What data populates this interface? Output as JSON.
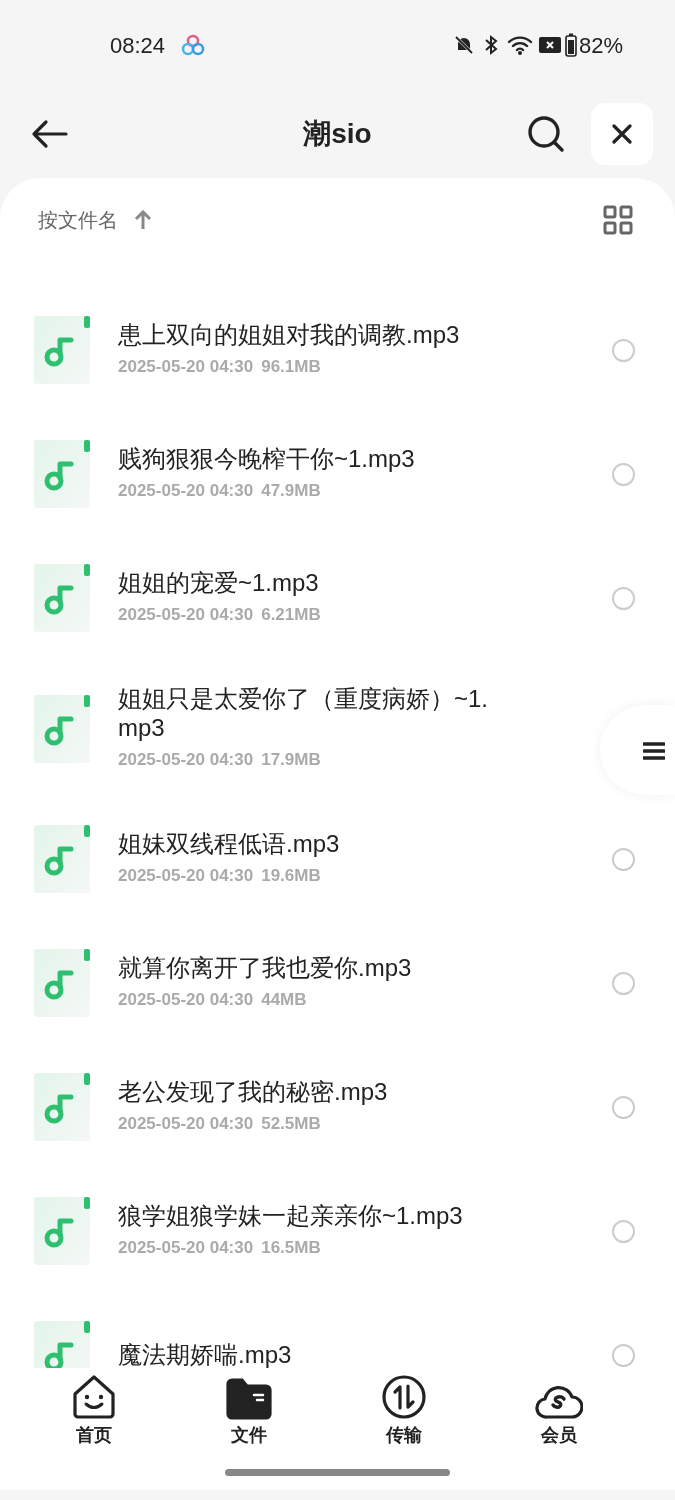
{
  "status_bar": {
    "time": "08:24",
    "battery_text": "82%"
  },
  "header": {
    "title": "潮sio"
  },
  "sort": {
    "label": "按文件名"
  },
  "files": [
    {
      "name": "患上双向的姐姐对我的调教.mp3",
      "date": "2025-05-20 04:30",
      "size": "96.1MB",
      "selected": false
    },
    {
      "name": "贱狗狠狠今晚榨干你~1.mp3",
      "date": "2025-05-20 04:30",
      "size": "47.9MB",
      "selected": false
    },
    {
      "name": "姐姐的宠爱~1.mp3",
      "date": "2025-05-20 04:30",
      "size": "6.21MB",
      "selected": false
    },
    {
      "name": "姐姐只是太爱你了（重度病娇）~1.mp3",
      "date": "2025-05-20 04:30",
      "size": "17.9MB"
    },
    {
      "name": "姐妹双线程低语.mp3",
      "date": "2025-05-20 04:30",
      "size": "19.6MB",
      "selected": false
    },
    {
      "name": "就算你离开了我也爱你.mp3",
      "date": "2025-05-20 04:30",
      "size": "44MB",
      "selected": false
    },
    {
      "name": "老公发现了我的秘密.mp3",
      "date": "2025-05-20 04:30",
      "size": "52.5MB",
      "selected": false
    },
    {
      "name": "狼学姐狼学妹一起亲亲你~1.mp3",
      "date": "2025-05-20 04:30",
      "size": "16.5MB",
      "selected": false
    },
    {
      "name": "魔法期娇喘.mp3",
      "selected": false
    }
  ],
  "nav": [
    {
      "kind": "home",
      "label": "首页",
      "selected": false
    },
    {
      "kind": "files",
      "label": "文件",
      "selected": true
    },
    {
      "kind": "transfer",
      "label": "传输",
      "selected": false
    },
    {
      "kind": "member",
      "label": "会员",
      "selected": false
    }
  ]
}
